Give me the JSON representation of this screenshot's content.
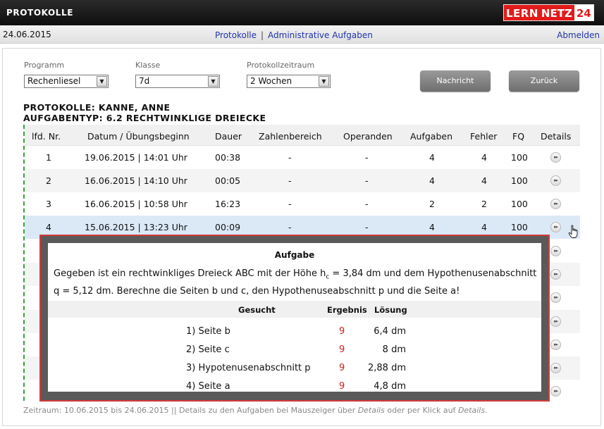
{
  "header": {
    "title": "PROTOKOLLE",
    "logo": {
      "part1": "LERN",
      "part2": "NETZ",
      "part3": "24"
    }
  },
  "subbar": {
    "date": "24.06.2015",
    "nav": [
      "Protokolle",
      "Administrative Aufgaben"
    ],
    "separator": "|",
    "logout": "Abmelden"
  },
  "filters": {
    "programm": {
      "label": "Programm",
      "value": "Rechenliesel"
    },
    "klasse": {
      "label": "Klasse",
      "value": "7d"
    },
    "zeitraum": {
      "label": "Protokollzeitraum",
      "value": "2 Wochen"
    }
  },
  "buttons": {
    "nachricht": "Nachricht",
    "zurueck": "Zurück"
  },
  "heading": {
    "line1": "PROTOKOLLE: KANNE, ANNE",
    "line2": "AUFGABENTYP: 6.2 RECHTWINKLIGE DREIECKE"
  },
  "table": {
    "columns": [
      "lfd. Nr.",
      "Datum / Übungsbeginn",
      "Dauer",
      "Zahlenbereich",
      "Operanden",
      "Aufgaben",
      "Fehler",
      "FQ",
      "Details"
    ],
    "rows": [
      {
        "nr": "1",
        "datum": "19.06.2015 | 14:01 Uhr",
        "dauer": "00:38",
        "zahlenbereich": "-",
        "operanden": "-",
        "aufgaben": "4",
        "fehler": "4",
        "fq": "100"
      },
      {
        "nr": "2",
        "datum": "16.06.2015 | 14:10 Uhr",
        "dauer": "00:05",
        "zahlenbereich": "-",
        "operanden": "-",
        "aufgaben": "4",
        "fehler": "4",
        "fq": "100"
      },
      {
        "nr": "3",
        "datum": "16.06.2015 | 10:58 Uhr",
        "dauer": "16:23",
        "zahlenbereich": "-",
        "operanden": "-",
        "aufgaben": "2",
        "fehler": "2",
        "fq": "100"
      },
      {
        "nr": "4",
        "datum": "15.06.2015 | 13:23 Uhr",
        "dauer": "00:09",
        "zahlenbereich": "-",
        "operanden": "-",
        "aufgaben": "4",
        "fehler": "4",
        "fq": "100"
      }
    ],
    "details_icon": "play-forward-icon"
  },
  "popup": {
    "title": "Aufgabe",
    "text_line1_a": "Gegeben ist ein rechtwinkliges Dreieck ABC mit der Höhe h",
    "text_line1_sub": "c",
    "text_line1_b": " = 3,84 dm und dem Hypothenusenabschnitt",
    "text_line2": "q = 5,12 dm. Berechne die Seiten b und c, den Hypothenuseabschnitt p und die Seite a!",
    "columns": [
      "Gesucht",
      "Ergebnis",
      "Lösung"
    ],
    "rows": [
      {
        "gesucht": "1) Seite b",
        "ergebnis": "9",
        "loesung": "6,4 dm"
      },
      {
        "gesucht": "2) Seite c",
        "ergebnis": "9",
        "loesung": "8 dm"
      },
      {
        "gesucht": "3) Hypotenusenabschnitt p",
        "ergebnis": "9",
        "loesung": "2,88 dm"
      },
      {
        "gesucht": "4) Seite a",
        "ergebnis": "9",
        "loesung": "4,8 dm"
      }
    ]
  },
  "footer": {
    "part1": "Zeitraum: 10.06.2015 bis 24.06.2015 || Details zu den Aufgaben bei Mauszeiger über ",
    "em1": "Details",
    "part2": " oder per Klick auf ",
    "em2": "Details",
    "part3": "."
  },
  "colors": {
    "accent": "#e31a1a",
    "link": "#2233aa",
    "error": "#cc2222",
    "highlight_row": "#dbe9f7"
  }
}
